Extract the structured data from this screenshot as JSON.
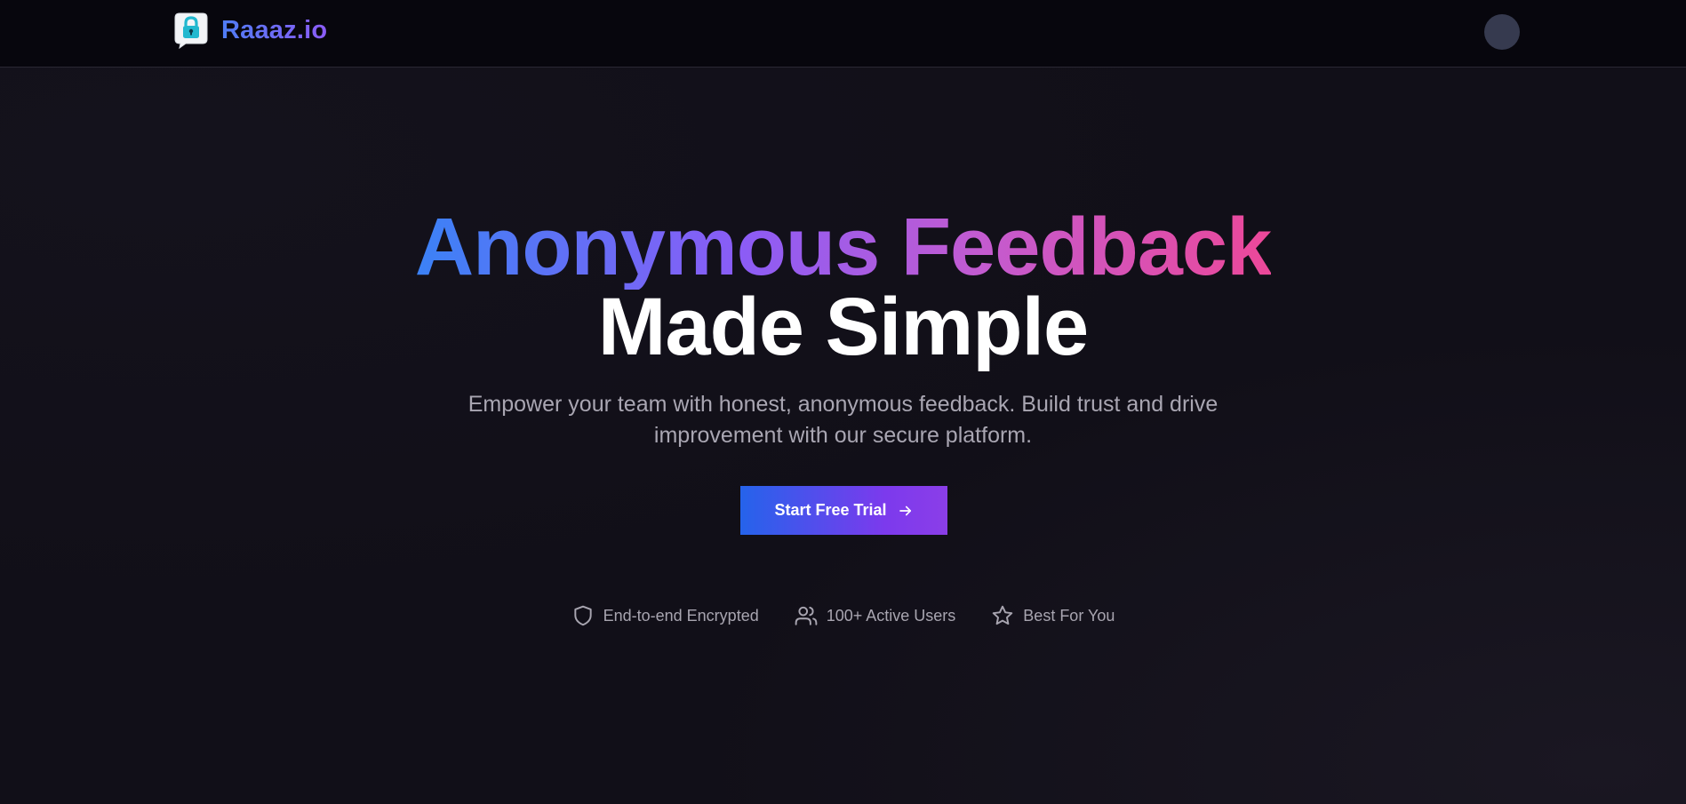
{
  "brand": {
    "name": "Raaaz.io",
    "logo_icon": "chat-lock-icon"
  },
  "user": {
    "avatar_icon": "avatar"
  },
  "hero": {
    "headline_gradient": "Anonymous Feedback",
    "headline_plain": "Made Simple",
    "subtitle": "Empower your team with honest, anonymous feedback. Build trust and drive improvement with our secure platform.",
    "cta_label": "Start Free Trial",
    "cta_icon": "arrow-right-icon"
  },
  "features": [
    {
      "label": "End-to-end Encrypted",
      "icon": "shield-icon"
    },
    {
      "label": "100+ Active Users",
      "icon": "users-icon"
    },
    {
      "label": "Best For You",
      "icon": "star-icon"
    }
  ],
  "colors": {
    "background": "#110f18",
    "navbar": "#07060d",
    "gradient_start": "#3b82f6",
    "gradient_mid": "#8b5cf6",
    "gradient_end": "#ec4899",
    "muted_text": "#a9a6b2",
    "avatar": "#363a4f"
  }
}
